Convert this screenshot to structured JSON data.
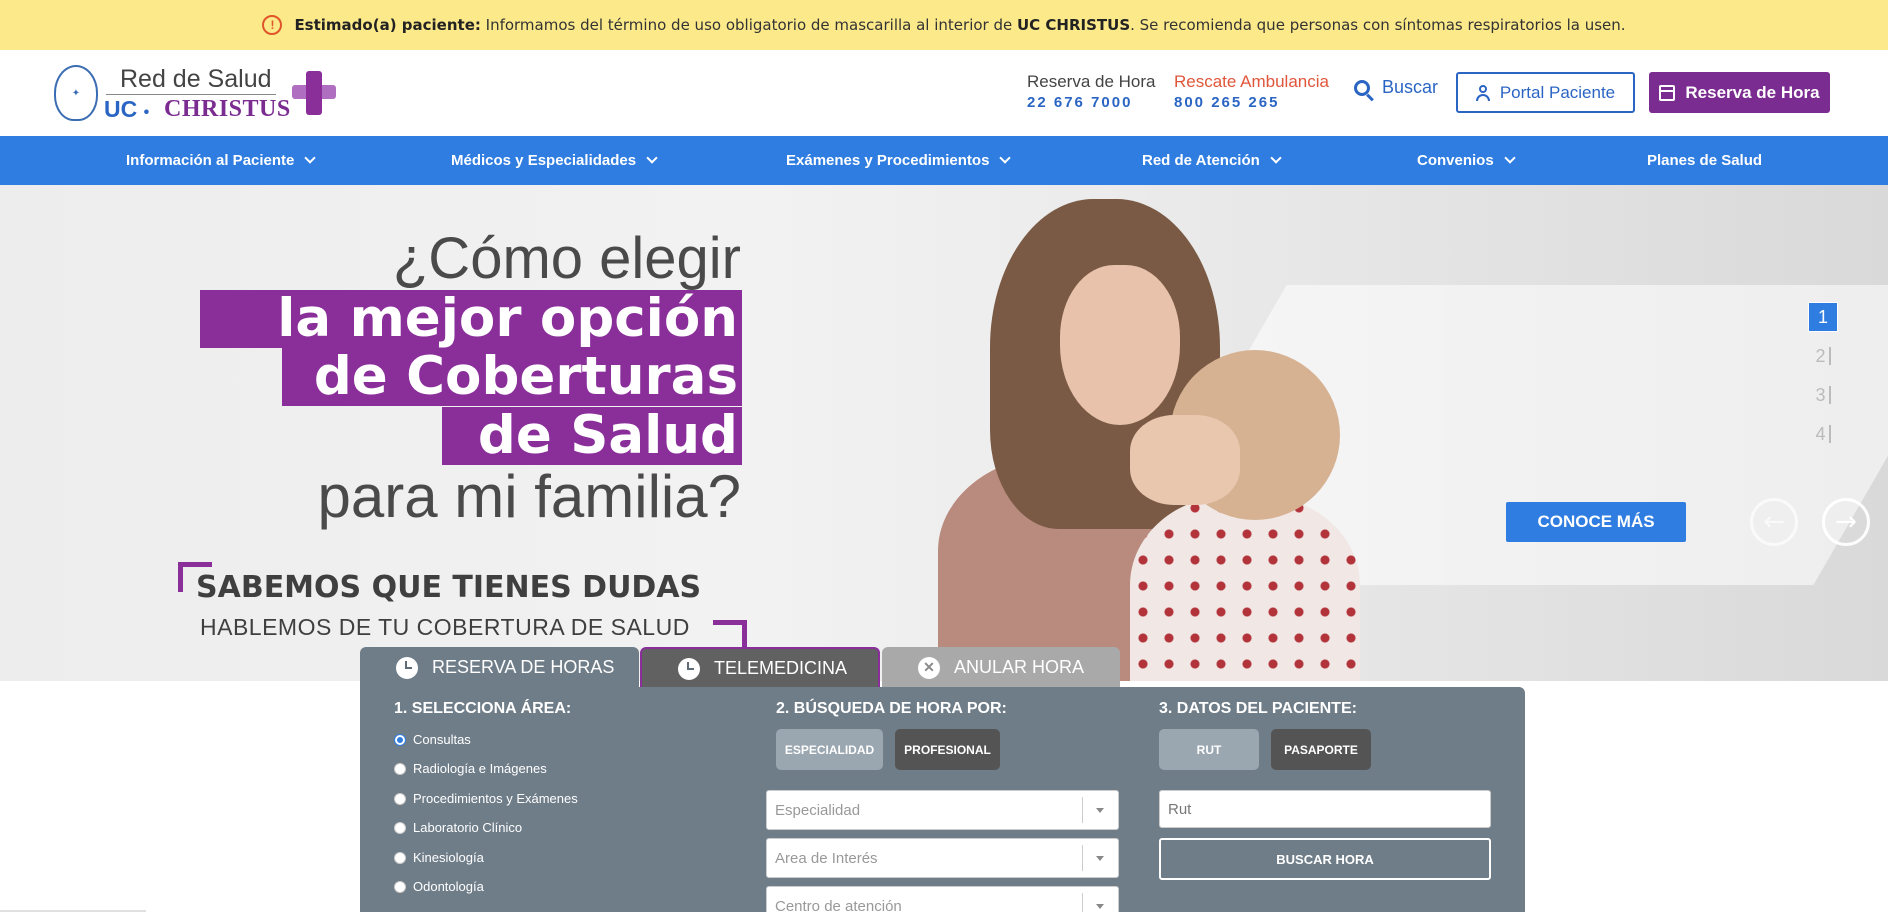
{
  "alert": {
    "icon": "warning-circle-icon",
    "lead": "Estimado(a) paciente:",
    "text_before": " Informamos del término de uso obligatorio de mascarilla al interior de ",
    "strong": "UC CHRISTUS",
    "text_after": ". Se recomienda que personas con síntomas respiratorios la usen.",
    "bg_color": "#fbe98a"
  },
  "header": {
    "logo": {
      "line1": "Red de Salud",
      "uc": "UC",
      "dot": "•",
      "christus": "CHRISTUS"
    },
    "reserva_label": "Reserva de Hora",
    "reserva_phone": "22 676 7000",
    "ambulancia_label": "Rescate Ambulancia",
    "ambulancia_phone": "800 265 265",
    "search_label": "Buscar",
    "portal_label": "Portal Paciente",
    "reserva_button": "Reserva de Hora"
  },
  "nav": {
    "items": [
      {
        "label": "Información al Paciente",
        "dropdown": true
      },
      {
        "label": "Médicos y Especialidades",
        "dropdown": true
      },
      {
        "label": "Exámenes y Procedimientos",
        "dropdown": true
      },
      {
        "label": "Red de Atención",
        "dropdown": true
      },
      {
        "label": "Convenios",
        "dropdown": true
      },
      {
        "label": "Planes de Salud",
        "dropdown": false
      }
    ],
    "bg_color": "#2f7de1"
  },
  "hero": {
    "line1": "¿Cómo elegir",
    "line2": "la mejor opción",
    "line3": "de Coberturas",
    "line4": "de Salud",
    "line5": "para mi familia?",
    "sub1": "SABEMOS QUE TIENES DUDAS",
    "sub2": "HABLEMOS DE TU COBERTURA DE SALUD",
    "cta": "CONOCE MÁS",
    "slides": [
      "1",
      "2",
      "3",
      "4"
    ],
    "active_slide": "1",
    "accent_color": "#8a2e9a"
  },
  "booking": {
    "tabs": [
      {
        "label": "RESERVA DE HORAS",
        "icon": "clock-icon"
      },
      {
        "label": "TELEMEDICINA",
        "icon": "clock-icon"
      },
      {
        "label": "ANULAR HORA",
        "icon": "close-circle-icon"
      }
    ],
    "step1_title": "1. SELECCIONA ÁREA:",
    "areas": [
      "Consultas",
      "Radiología e Imágenes",
      "Procedimientos y Exámenes",
      "Laboratorio Clínico",
      "Kinesiología",
      "Odontología"
    ],
    "selected_area": "Consultas",
    "step2_title": "2. BÚSQUEDA DE HORA POR:",
    "search_by": [
      "ESPECIALIDAD",
      "PROFESIONAL"
    ],
    "selects": [
      "Especialidad",
      "Area de Interés",
      "Centro de atención"
    ],
    "step3_title": "3. DATOS DEL PACIENTE:",
    "id_types": [
      "RUT",
      "PASAPORTE"
    ],
    "rut_placeholder": "Rut",
    "submit": "BUSCAR HORA"
  }
}
